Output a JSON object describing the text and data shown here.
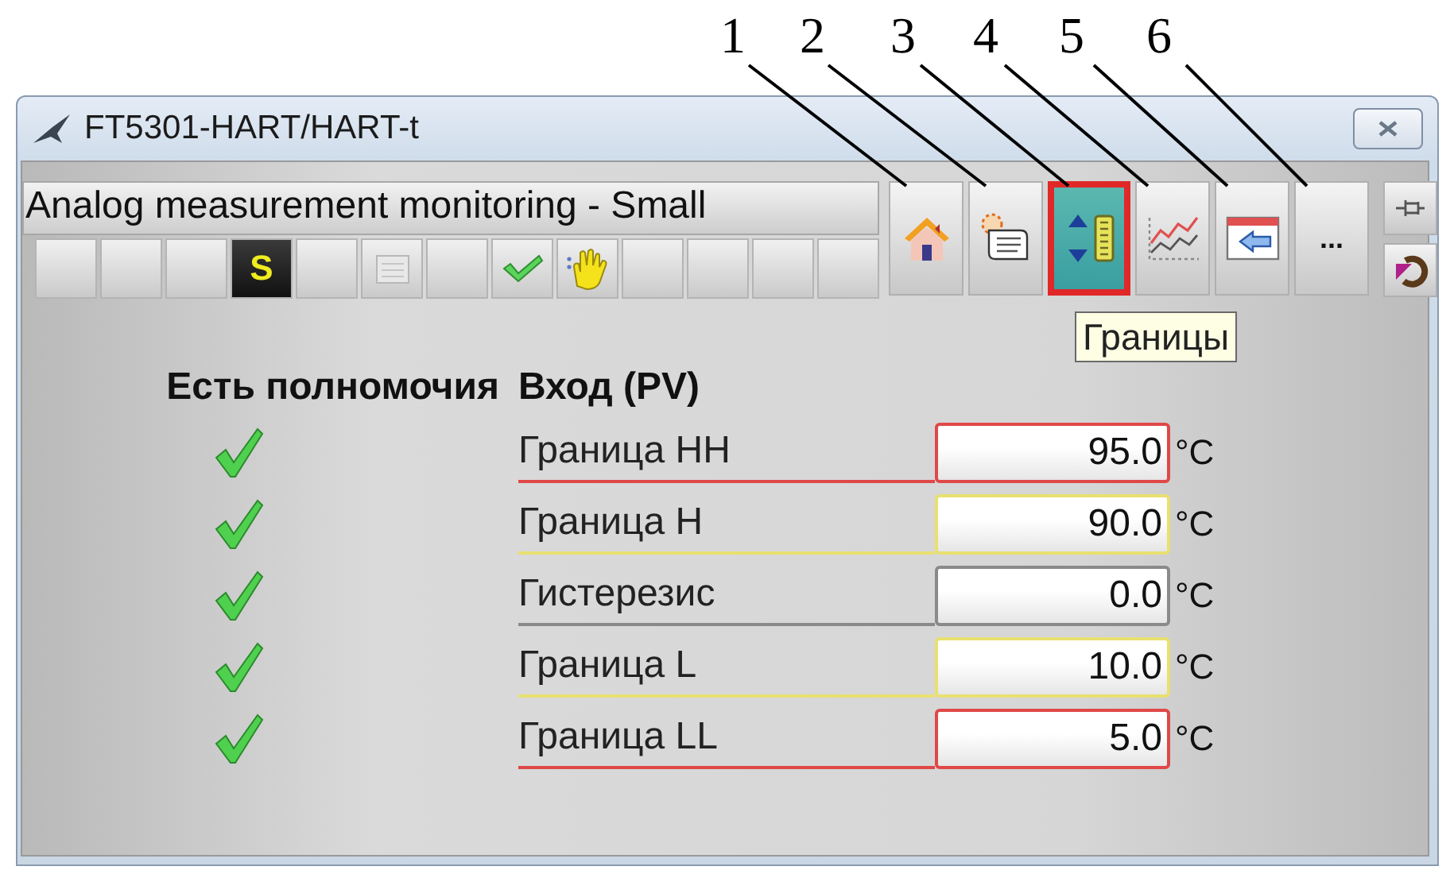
{
  "callouts": [
    {
      "label": "1"
    },
    {
      "label": "2"
    },
    {
      "label": "3"
    },
    {
      "label": "4"
    },
    {
      "label": "5"
    },
    {
      "label": "6"
    }
  ],
  "window": {
    "title": "FT5301-HART/HART-t"
  },
  "faceplate": {
    "title": "Analog measurement monitoring - Small",
    "status_slots": [
      {
        "kind": "empty"
      },
      {
        "kind": "empty"
      },
      {
        "kind": "empty"
      },
      {
        "kind": "letter",
        "text": "S"
      },
      {
        "kind": "empty"
      },
      {
        "kind": "calendar"
      },
      {
        "kind": "empty"
      },
      {
        "kind": "check"
      },
      {
        "kind": "hand"
      },
      {
        "kind": "empty"
      },
      {
        "kind": "empty"
      },
      {
        "kind": "empty"
      },
      {
        "kind": "empty"
      }
    ],
    "buttons": [
      {
        "kind": "home",
        "selected": false
      },
      {
        "kind": "document",
        "selected": false
      },
      {
        "kind": "limits",
        "selected": true
      },
      {
        "kind": "trend",
        "selected": false
      },
      {
        "kind": "back",
        "selected": false
      },
      {
        "kind": "more",
        "label": "...",
        "selected": false
      }
    ],
    "side_buttons": [
      {
        "kind": "pin"
      },
      {
        "kind": "undo"
      }
    ],
    "tooltip": "Границы"
  },
  "table": {
    "columns": [
      "Есть полномочия",
      "Вход (PV)"
    ],
    "rows": [
      {
        "authorized": true,
        "label": "Граница HH",
        "value": "95.0",
        "unit": "°C",
        "color": "#e04848"
      },
      {
        "authorized": true,
        "label": "Граница H",
        "value": "90.0",
        "unit": "°C",
        "color": "#e8e070"
      },
      {
        "authorized": true,
        "label": "Гистерезис",
        "value": "0.0",
        "unit": "°C",
        "color": "#8a8a8a"
      },
      {
        "authorized": true,
        "label": "Граница L",
        "value": "10.0",
        "unit": "°C",
        "color": "#e8e070"
      },
      {
        "authorized": true,
        "label": "Граница LL",
        "value": "5.0",
        "unit": "°C",
        "color": "#e04848"
      }
    ]
  }
}
